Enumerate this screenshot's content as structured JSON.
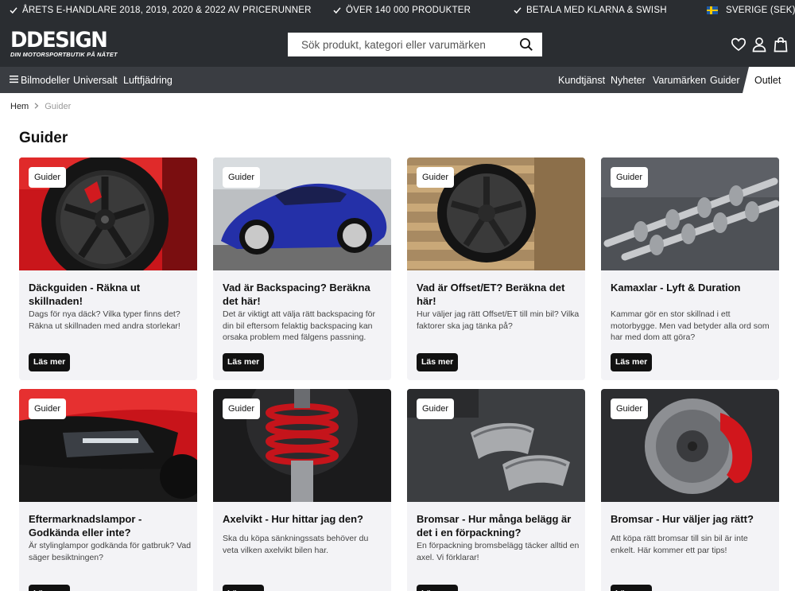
{
  "topbar": {
    "promo1": "ÅRETS E-HANDLARE 2018, 2019, 2020 & 2022 AV PRICERUNNER",
    "promo2": "ÖVER 140 000 PRODUKTER",
    "promo3": "BETALA MED KLARNA & SWISH",
    "region": "SVERIGE (SEK)"
  },
  "header": {
    "logo_main": "DDESIGN",
    "logo_sub": "DIN MOTORSPORTBUTIK PÅ NÄTET",
    "search_placeholder": "Sök produkt, kategori eller varumärken"
  },
  "nav": {
    "left": [
      "Bilmodeller",
      "Universalt",
      "Luftfjädring"
    ],
    "right": [
      "Kundtjänst",
      "Nyheter",
      "Varumärken",
      "Guider"
    ],
    "outlet": "Outlet"
  },
  "breadcrumb": {
    "home": "Hem",
    "current": "Guider"
  },
  "page_title": "Guider",
  "cards": [
    {
      "tag": "Guider",
      "title": "Däckguiden - Räkna ut skillnaden!",
      "excerpt": "Dags för nya däck? Vilka typer finns det? Räkna ut skillnaden med andra storlekar!",
      "button": "Läs mer",
      "image": "tire-wheel-image"
    },
    {
      "tag": "Guider",
      "title": "Vad är Backspacing? Beräkna det här!",
      "excerpt": "Det är viktigt att välja rätt backspacing för din bil eftersom felaktig backspacing kan orsaka problem med fälgens passning.",
      "button": "Läs mer",
      "image": "blue-car-image"
    },
    {
      "tag": "Guider",
      "title": "Vad är Offset/ET? Beräkna det här!",
      "excerpt": "Hur väljer jag rätt Offset/ET till min bil? Vilka faktorer ska jag tänka på?",
      "button": "Läs mer",
      "image": "wheel-on-pallets-image"
    },
    {
      "tag": "Guider",
      "title": "Kamaxlar - Lyft & Duration",
      "excerpt": "Kammar gör en stor skillnad i ett motorbygge. Men vad betyder alla ord som har med dom att göra?",
      "button": "Läs mer",
      "image": "camshafts-image"
    },
    {
      "tag": "Guider",
      "title": "Eftermarknadslampor - Godkända eller inte?",
      "excerpt": "Är stylinglampor godkända för gatbruk? Vad säger besiktningen?",
      "button": "Läs mer",
      "image": "headlight-image"
    },
    {
      "tag": "Guider",
      "title": "Axelvikt - Hur hittar jag den?",
      "excerpt": "Ska du köpa sänkningssats behöver du veta vilken axelvikt bilen har.",
      "button": "Läs mer",
      "image": "coilover-image"
    },
    {
      "tag": "Guider",
      "title": "Bromsar - Hur många belägg är det i en förpackning?",
      "excerpt": "En förpackning bromsbelägg täcker alltid en axel. Vi förklarar!",
      "button": "Läs mer",
      "image": "brake-pads-image"
    },
    {
      "tag": "Guider",
      "title": "Bromsar - Hur väljer jag rätt?",
      "excerpt": "Att köpa rätt bromsar till sin bil är inte enkelt. Här kommer ett par tips!",
      "button": "Läs mer",
      "image": "brake-caliper-image"
    }
  ]
}
